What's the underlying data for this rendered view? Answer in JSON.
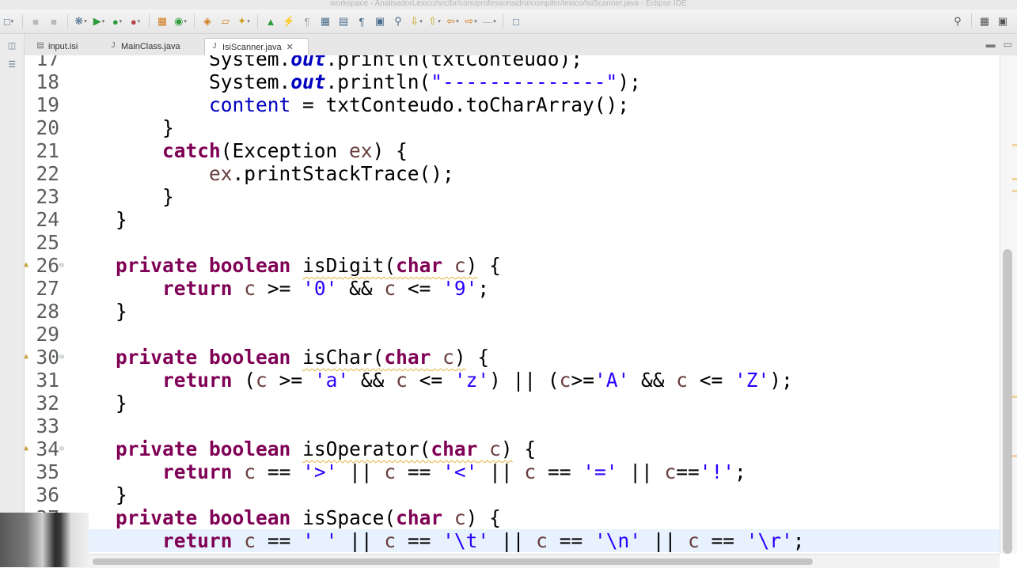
{
  "window": {
    "title": "workspace - AnalisadorLexico/src/br/com/professorisidro/compiler/lexico/IsiScanner.java - Eclipse IDE"
  },
  "tabs": [
    {
      "label": "input.isi",
      "active": false
    },
    {
      "label": "MainClass.java",
      "active": false
    },
    {
      "label": "IsiScanner.java",
      "active": true
    }
  ],
  "editor": {
    "lines": [
      {
        "n": "17",
        "html": "            System.<span class=\"fld\">out</span>.println(txtConteudo);"
      },
      {
        "n": "18",
        "html": "            System.<span class=\"fld\">out</span>.println(<span class=\"st\">\"--------------\"</span>);"
      },
      {
        "n": "19",
        "html": "            <span class=\"id\">content</span> = txtConteudo.toCharArray();"
      },
      {
        "n": "20",
        "html": "        }"
      },
      {
        "n": "21",
        "html": "        <span class=\"kw\">catch</span>(Exception <span class=\"pr\">ex</span>) {"
      },
      {
        "n": "22",
        "html": "            <span class=\"pr\">ex</span>.printStackTrace();"
      },
      {
        "n": "23",
        "html": "        }"
      },
      {
        "n": "24",
        "html": "    }"
      },
      {
        "n": "25",
        "html": ""
      },
      {
        "n": "26",
        "marker": true,
        "fold": true,
        "html": "    <span class=\"kw\">private</span> <span class=\"kw\">boolean</span> <span class=\"warn\">isDigit(<span class=\"kw\">char</span> <span class=\"pr\">c</span>)</span> {"
      },
      {
        "n": "27",
        "html": "        <span class=\"kw\">return</span> <span class=\"pr\">c</span> &gt;= <span class=\"st\">'0'</span> &amp;&amp; <span class=\"pr\">c</span> &lt;= <span class=\"st\">'9'</span>;"
      },
      {
        "n": "28",
        "html": "    }"
      },
      {
        "n": "29",
        "html": ""
      },
      {
        "n": "30",
        "marker": true,
        "fold": true,
        "html": "    <span class=\"kw\">private</span> <span class=\"kw\">boolean</span> <span class=\"warn\">isChar(<span class=\"kw\">char</span> <span class=\"pr\">c</span>)</span> {"
      },
      {
        "n": "31",
        "html": "        <span class=\"kw\">return</span> (<span class=\"pr\">c</span> &gt;= <span class=\"st\">'a'</span> &amp;&amp; <span class=\"pr\">c</span> &lt;= <span class=\"st\">'z'</span>) || (<span class=\"pr\">c</span>&gt;=<span class=\"st\">'A'</span> &amp;&amp; <span class=\"pr\">c</span> &lt;= <span class=\"st\">'Z'</span>);"
      },
      {
        "n": "32",
        "html": "    }"
      },
      {
        "n": "33",
        "html": ""
      },
      {
        "n": "34",
        "marker": true,
        "fold": true,
        "html": "    <span class=\"kw\">private</span> <span class=\"kw\">boolean</span> <span class=\"warn\">isOperator(<span class=\"kw\">char</span> <span class=\"pr\">c</span>)</span> {"
      },
      {
        "n": "35",
        "html": "        <span class=\"kw\">return</span> <span class=\"pr\">c</span> == <span class=\"st\">'&gt;'</span> || <span class=\"pr\">c</span> == <span class=\"st\">'&lt;'</span> || <span class=\"pr\">c</span> == <span class=\"st\">'='</span> || <span class=\"pr\">c</span>==<span class=\"st\">'!'</span>;"
      },
      {
        "n": "36",
        "html": "    }"
      },
      {
        "n": "37",
        "html": "    <span class=\"kw\">private</span> <span class=\"kw\">boolean</span> <span class=\"warn\">isSpace(<span class=\"kw\">char</span> <span class=\"pr\">c</span>)</span> {"
      },
      {
        "n": "38",
        "current": true,
        "html": "        <span class=\"kw\">return</span> <span class=\"pr\">c</span> == <span class=\"st\">' '</span> || <span class=\"pr\">c</span> == <span class=\"st\">'\\t'</span> || <span class=\"pr\">c</span> == <span class=\"st\">'\\n'</span> || <span class=\"pr\">c</span> == <span class=\"st\">'\\r'</span>;"
      }
    ]
  },
  "icons": {
    "toolbar": [
      "new-icon",
      "save-icon",
      "run-debug-icon",
      "run-icon",
      "run-external-icon",
      "build-icon",
      "coverage-icon",
      "new-java-project-icon",
      "new-package-icon",
      "new-class-icon",
      "open-type-icon",
      "search-icon",
      "annotation-icon",
      "pin-icon",
      "next-annotation-icon",
      "back-icon",
      "forward-icon",
      "open-perspective-icon"
    ],
    "right": [
      "search-icon",
      "perspective-icon"
    ]
  },
  "colors": {
    "keyword": "#7f0055",
    "field": "#0000c0",
    "string": "#2a00ff",
    "param": "#6a3e3e",
    "current_line": "#e8f2fe"
  }
}
